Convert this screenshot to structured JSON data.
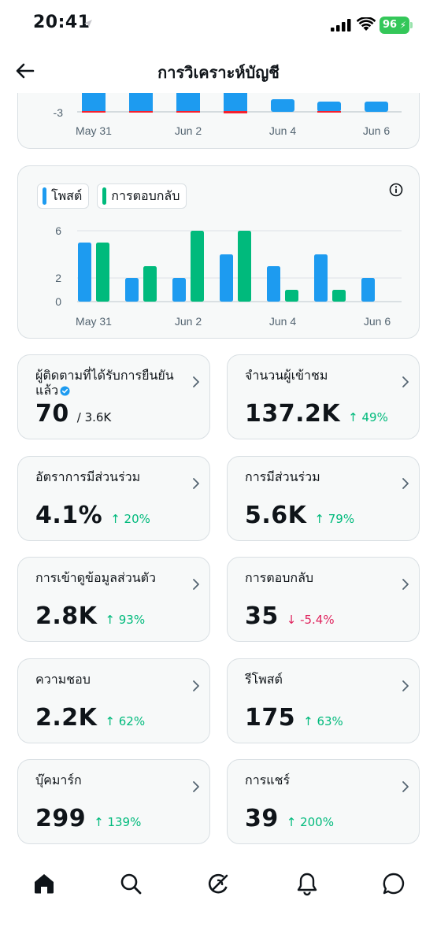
{
  "status_bar": {
    "time": "20:41",
    "battery": "96"
  },
  "header": {
    "title": "การวิเคราะห์บัญชี"
  },
  "top_chart": {
    "y_tick": "-3",
    "x_ticks": [
      "May 31",
      "Jun 2",
      "Jun 4",
      "Jun 6"
    ]
  },
  "legend": {
    "posts": "โพสต์",
    "replies": "การตอบกลับ"
  },
  "colors": {
    "posts": "#1d9bf0",
    "replies": "#00ba7c",
    "negative": "#f4212e",
    "up": "#00ba7c",
    "down": "#e0245e"
  },
  "chart_data": {
    "type": "bar",
    "categories": [
      "May 31",
      "Jun 1",
      "Jun 2",
      "Jun 3",
      "Jun 4",
      "Jun 5",
      "Jun 6"
    ],
    "x_tick_labels": [
      "May 31",
      "Jun 2",
      "Jun 4",
      "Jun 6"
    ],
    "y_ticks": [
      0,
      2,
      6
    ],
    "ylim": [
      0,
      6
    ],
    "series": [
      {
        "name": "โพสต์",
        "color": "#1d9bf0",
        "values": [
          5,
          2,
          2,
          4,
          3,
          4,
          2
        ]
      },
      {
        "name": "การตอบกลับ",
        "color": "#00ba7c",
        "values": [
          5,
          3,
          6,
          6,
          1,
          1,
          0
        ]
      }
    ]
  },
  "metrics": [
    {
      "label": "ผู้ติดตามที่ได้รับการยืนยันแล้ว",
      "value": "70",
      "sub": "/ 3.6K",
      "delta": "",
      "dir": ""
    },
    {
      "label": "จำนวนผู้เข้าชม",
      "value": "137.2K",
      "sub": "",
      "delta": "↑ 49%",
      "dir": "up"
    },
    {
      "label": "อัตราการมีส่วนร่วม",
      "value": "4.1%",
      "sub": "",
      "delta": "↑ 20%",
      "dir": "up"
    },
    {
      "label": "การมีส่วนร่วม",
      "value": "5.6K",
      "sub": "",
      "delta": "↑ 79%",
      "dir": "up"
    },
    {
      "label": "การเข้าดูข้อมูลส่วนตัว",
      "value": "2.8K",
      "sub": "",
      "delta": "↑ 93%",
      "dir": "up"
    },
    {
      "label": "การตอบกลับ",
      "value": "35",
      "sub": "",
      "delta": "↓ -5.4%",
      "dir": "down"
    },
    {
      "label": "ความชอบ",
      "value": "2.2K",
      "sub": "",
      "delta": "↑ 62%",
      "dir": "up"
    },
    {
      "label": "รีโพสต์",
      "value": "175",
      "sub": "",
      "delta": "↑ 63%",
      "dir": "up"
    },
    {
      "label": "บุ๊คมาร์ก",
      "value": "299",
      "sub": "",
      "delta": "↑ 139%",
      "dir": "up"
    },
    {
      "label": "การแชร์",
      "value": "39",
      "sub": "",
      "delta": "↑ 200%",
      "dir": "up"
    }
  ],
  "nav": [
    "home-icon",
    "search-icon",
    "grok-icon",
    "notifications-icon",
    "messages-icon"
  ]
}
